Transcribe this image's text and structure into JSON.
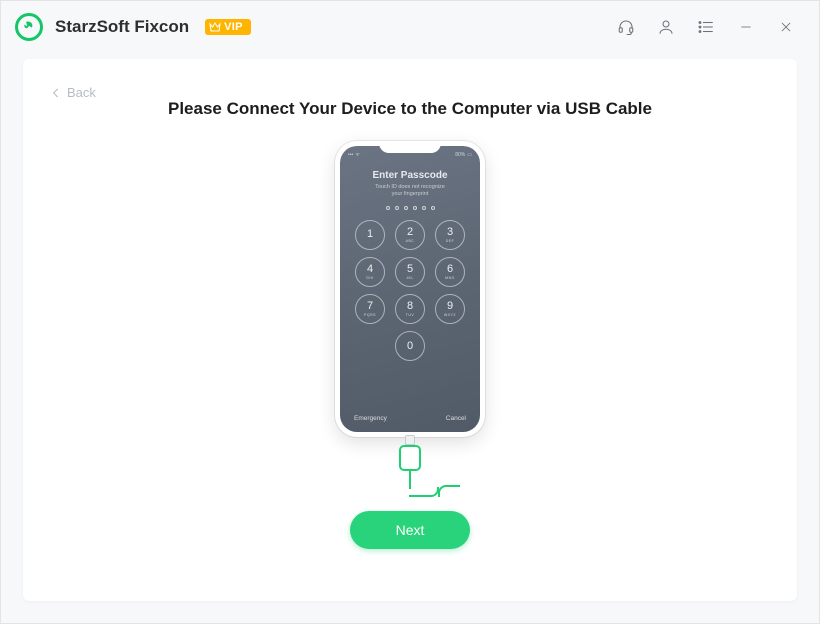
{
  "app": {
    "title": "StarzSoft Fixcon",
    "vip_label": "VIP"
  },
  "titlebar_icons": {
    "support": "headset-icon",
    "account": "user-icon",
    "menu": "menu-icon",
    "minimize": "minimize-icon",
    "close": "close-icon"
  },
  "nav": {
    "back_label": "Back"
  },
  "main": {
    "heading": "Please Connect Your Device to the Computer via USB Cable",
    "next_label": "Next"
  },
  "phone": {
    "title": "Enter Passcode",
    "subtitle_line1": "Touch ID does not recognize",
    "subtitle_line2": "your fingerprint",
    "emergency": "Emergency",
    "cancel": "Cancel",
    "keys": [
      {
        "num": "1",
        "let": ""
      },
      {
        "num": "2",
        "let": "ABC"
      },
      {
        "num": "3",
        "let": "DEF"
      },
      {
        "num": "4",
        "let": "GHI"
      },
      {
        "num": "5",
        "let": "JKL"
      },
      {
        "num": "6",
        "let": "MNO"
      },
      {
        "num": "7",
        "let": "PQRS"
      },
      {
        "num": "8",
        "let": "TUV"
      },
      {
        "num": "9",
        "let": "WXYZ"
      },
      {
        "num": "0",
        "let": ""
      }
    ]
  }
}
